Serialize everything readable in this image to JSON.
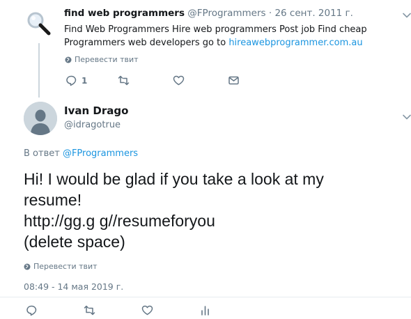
{
  "tweet1": {
    "author_name": "find web programmers",
    "author_handle": "@FProgrammers",
    "separator": "·",
    "date": "26 сент. 2011 г.",
    "body_text": "Find Web Programmers Hire web programmers Post job Find cheap Programmers web developers go to",
    "body_link": "hireawebprogrammer.com.au",
    "translate_label": "Перевести твит",
    "reply_count": "1"
  },
  "tweet2": {
    "author_name": "Ivan Drago",
    "author_handle": "@idragotrue",
    "reply_prefix": "В ответ",
    "reply_to": "@FProgrammers",
    "text_lines": [
      "Hi! I would be glad if you take a look at my",
      "resume!",
      "http://gg.g g//resumeforyou",
      "(delete space)"
    ],
    "translate_label": "Перевести твит",
    "timestamp": "08:49 - 14 мая 2019 г."
  },
  "colors": {
    "link": "#1b95e0",
    "muted": "#657786",
    "avatar_bg": "#ccd6dd",
    "thread_line": "#ccd6dd"
  },
  "icons": [
    "magnifier-avatar",
    "chevron-down-icon",
    "globe-icon",
    "reply-icon",
    "retweet-icon",
    "like-icon",
    "dm-icon",
    "analytics-icon",
    "default-avatar"
  ]
}
